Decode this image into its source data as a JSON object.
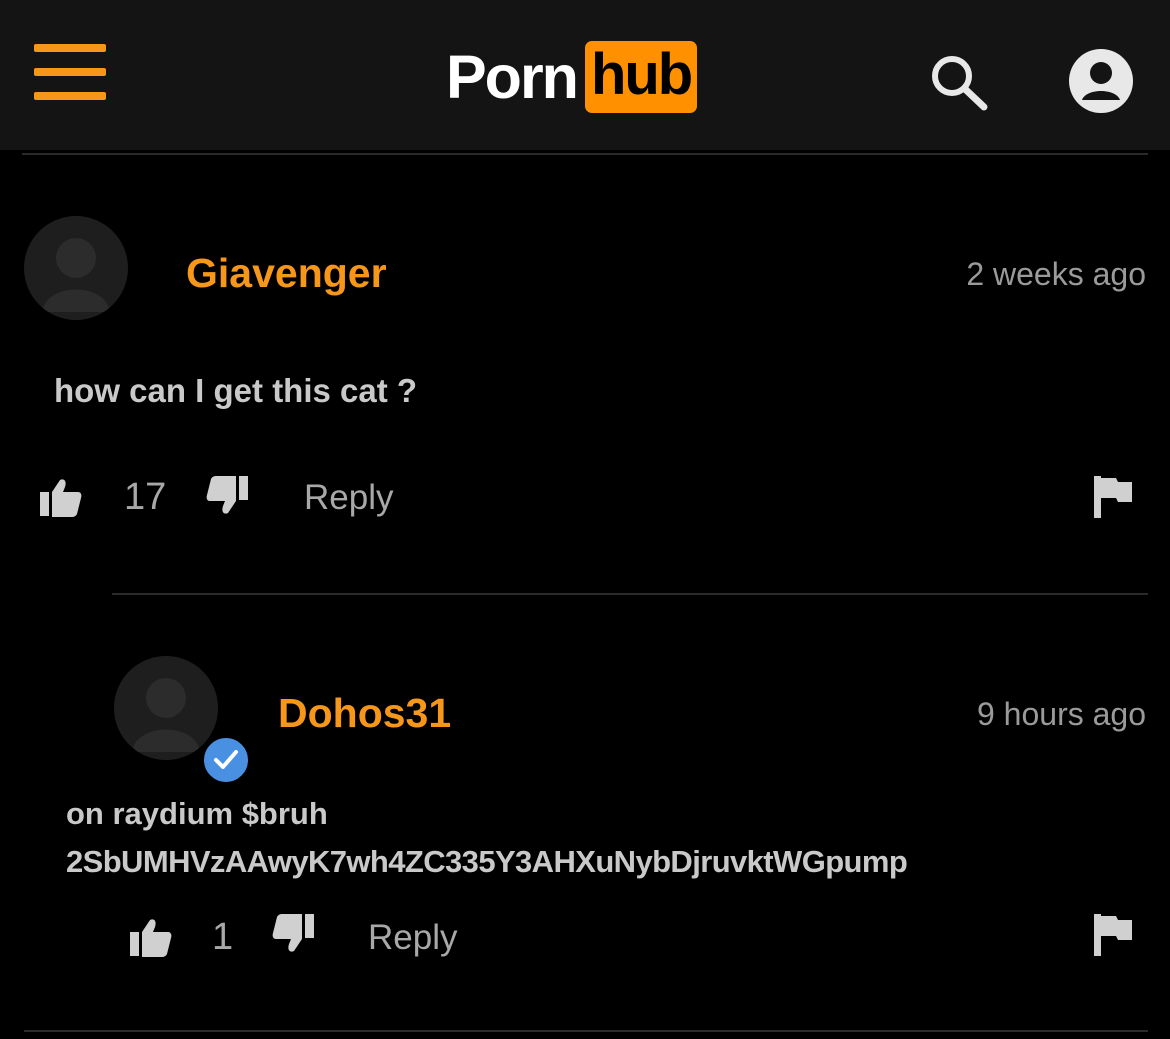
{
  "header": {
    "logo_part1": "Porn",
    "logo_part2": "hub",
    "menu_icon": "hamburger-menu-icon",
    "search_icon": "search-icon",
    "account_icon": "user-account-icon"
  },
  "colors": {
    "accent": "#ff9000",
    "username": "#f7971a",
    "background": "#000000",
    "header_bg": "#141414",
    "verified": "#4a90e2"
  },
  "comments": [
    {
      "username": "Giavenger",
      "timestamp": "2 weeks ago",
      "body_lines": [
        "how can I get this cat ?"
      ],
      "likes": "17",
      "reply_label": "Reply",
      "verified": false
    },
    {
      "username": "Dohos31",
      "timestamp": "9 hours ago",
      "body_lines": [
        "on raydium $bruh",
        "2SbUMHVzAAwyK7wh4ZC335Y3AHXuNybDjruvktWGpump"
      ],
      "likes": "1",
      "reply_label": "Reply",
      "verified": true
    }
  ]
}
